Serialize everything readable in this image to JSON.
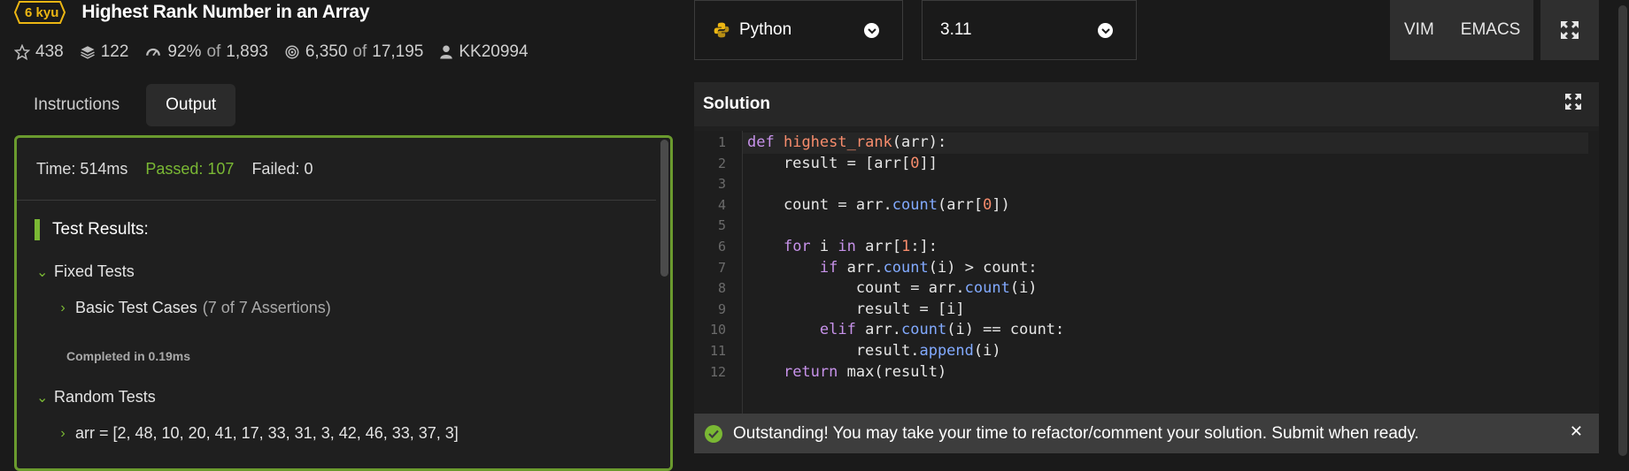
{
  "kata": {
    "kyu": "6 kyu",
    "title": "Highest Rank Number in an Array",
    "stats": {
      "stars": "438",
      "collections": "122",
      "satisfaction": "92%",
      "of_word_1": "of",
      "votes": "1,893",
      "completed": "6,350",
      "of_word_2": "of",
      "attempted": "17,195",
      "author": "KK20994"
    }
  },
  "tabs": [
    {
      "label": "Instructions",
      "active": false
    },
    {
      "label": "Output",
      "active": true
    }
  ],
  "output": {
    "time": "Time: 514ms",
    "passed": "Passed: 107",
    "failed": "Failed: 0",
    "test_results_label": "Test Results:",
    "fixed_tests": "Fixed Tests",
    "basic_cases": "Basic Test Cases",
    "basic_cases_sub": "(7 of 7 Assertions)",
    "completed_in": "Completed in 0.19ms",
    "random_tests": "Random Tests",
    "random_case": "arr = [2, 48, 10, 20, 41, 17, 33, 31, 3, 42, 46, 33, 37, 3]"
  },
  "editor_controls": {
    "language": "Python",
    "version": "3.11",
    "vim_label": "VIM",
    "emacs_label": "EMACS"
  },
  "solution": {
    "header": "Solution",
    "line_numbers": [
      "1",
      "2",
      "3",
      "4",
      "5",
      "6",
      "7",
      "8",
      "9",
      "10",
      "11",
      "12"
    ],
    "lines": [
      "def highest_rank(arr):",
      "    result = [arr[0]]",
      "",
      "    count = arr.count(arr[0])",
      "",
      "    for i in arr[1:]:",
      "        if arr.count(i) > count:",
      "            count = arr.count(i)",
      "            result = [i]",
      "        elif arr.count(i) == count:",
      "            result.append(i)",
      "    return max(result)"
    ]
  },
  "toast": {
    "message": "Outstanding! You may take your time to refactor/comment your solution. Submit when ready.",
    "close": "✕"
  },
  "colors": {
    "accent_green": "#7ab834",
    "kyu_yellow": "#ecb613",
    "panel_border": "#6a9a2e"
  }
}
